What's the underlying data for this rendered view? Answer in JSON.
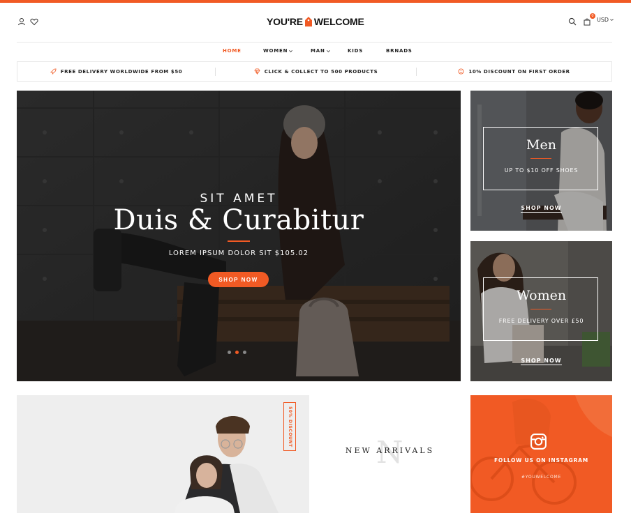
{
  "brand": {
    "logo_left": "YOU'RE",
    "logo_right": "WELCOME",
    "accent_color": "#f15a24"
  },
  "header": {
    "account_icon": "user-icon",
    "wishlist_icon": "heart-icon",
    "search_icon": "search-icon",
    "cart_icon": "cart-icon",
    "cart_count": "0",
    "currency": "USD"
  },
  "nav": {
    "items": [
      {
        "label": "HOME",
        "active": true,
        "dropdown": false
      },
      {
        "label": "WOMEN",
        "active": false,
        "dropdown": true
      },
      {
        "label": "MAN",
        "active": false,
        "dropdown": true
      },
      {
        "label": "KIDS",
        "active": false,
        "dropdown": false
      },
      {
        "label": "BRNADS",
        "active": false,
        "dropdown": false
      }
    ]
  },
  "features": [
    {
      "icon": "rocket-icon",
      "label": "FREE DELIVERY WORLDWIDE FROM $50"
    },
    {
      "icon": "diamond-icon",
      "label": "CLICK & COLLECT TO 500 PRODUCTS"
    },
    {
      "icon": "smile-icon",
      "label": "10% DISCOUNT ON FIRST ORDER"
    }
  ],
  "hero": {
    "subtitle": "SIT AMET",
    "title": "Duis & Curabitur",
    "caption": "LOREM IPSUM DOLOR SIT $105.02",
    "button": "SHOP NOW",
    "slides": 3,
    "active_slide": 2
  },
  "banners": {
    "men": {
      "title": "Men",
      "caption": "UP TO $10 OFF SHOES",
      "link": "SHOP NOW"
    },
    "women": {
      "title": "Women",
      "caption": "FREE DELIVERY OVER £50",
      "link": "SHOP NOW"
    }
  },
  "promo": {
    "badge": "50% DISCOUNT"
  },
  "arrivals": {
    "letter": "N",
    "title": "NEW ARRIVALS"
  },
  "instagram": {
    "follow": "FOLLOW US ON INSTAGRAM",
    "handle": "#YOUWELCOME"
  }
}
